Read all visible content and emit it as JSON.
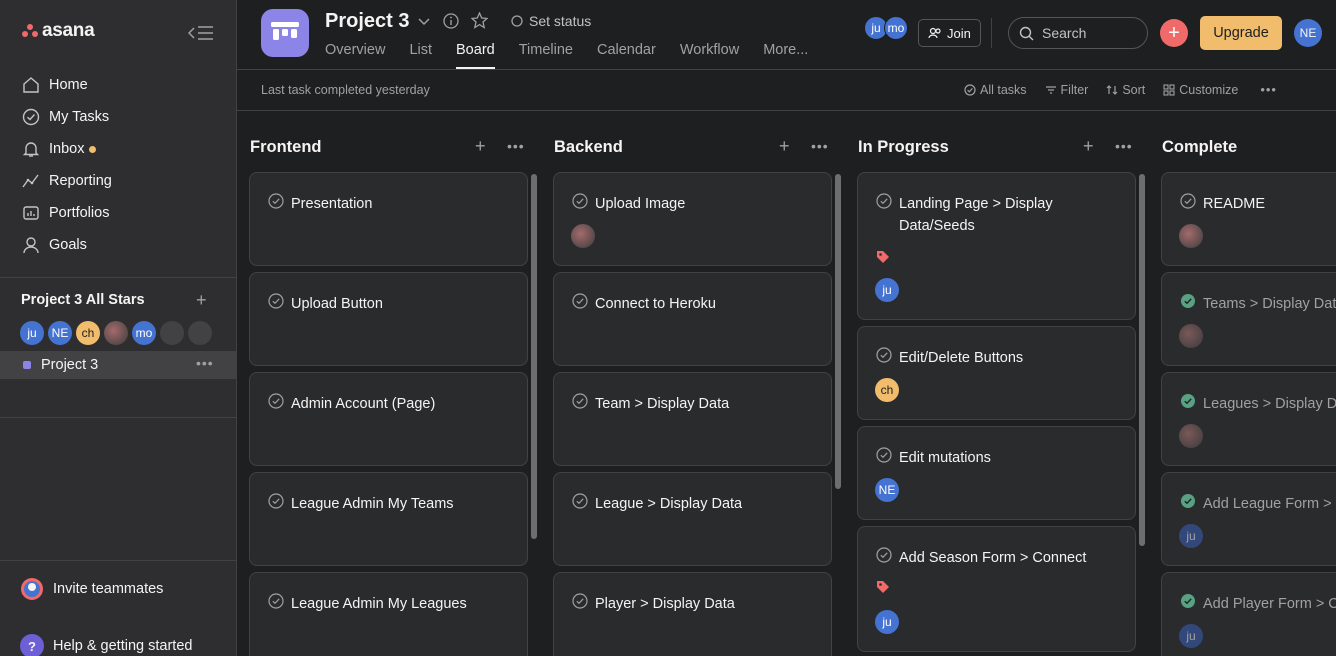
{
  "sidebar": {
    "logo": "asana",
    "nav": [
      {
        "label": "Home",
        "icon": "home-icon"
      },
      {
        "label": "My Tasks",
        "icon": "check-circle-icon"
      },
      {
        "label": "Inbox",
        "icon": "bell-icon"
      },
      {
        "label": "Reporting",
        "icon": "chart-line-icon"
      },
      {
        "label": "Portfolios",
        "icon": "portfolio-icon"
      },
      {
        "label": "Goals",
        "icon": "goals-icon"
      }
    ],
    "team_title": "Project 3 All Stars",
    "team_members": [
      "ju",
      "NE",
      "ch",
      "",
      "mo",
      "",
      ""
    ],
    "project": "Project 3",
    "invite": "Invite teammates",
    "help": "Help & getting started"
  },
  "header": {
    "title": "Project 3",
    "set_status": "Set status",
    "tabs": [
      "Overview",
      "List",
      "Board",
      "Timeline",
      "Calendar",
      "Workflow",
      "More..."
    ],
    "active_tab": "Board",
    "members": [
      "ju",
      "mo"
    ],
    "join": "Join",
    "search_placeholder": "Search",
    "upgrade": "Upgrade",
    "user": "NE"
  },
  "subbar": {
    "last_task": "Last task completed yesterday",
    "actions": [
      "All tasks",
      "Filter",
      "Sort",
      "Customize"
    ]
  },
  "colors": {
    "accent": "#f06a6a",
    "upgrade": "#f1bd6c",
    "project": "#8d84e8"
  },
  "board": {
    "columns": [
      {
        "name": "Frontend",
        "cards": [
          "Presentation",
          "Upload Button",
          "Admin Account (Page)",
          "League Admin My Teams",
          "League Admin My Leagues"
        ]
      },
      {
        "name": "Backend",
        "cards": [
          "Upload Image",
          "Connect to Heroku",
          "Team > Display Data",
          "League > Display Data",
          "Player > Display Data"
        ]
      },
      {
        "name": "In Progress",
        "cards": [
          "Landing Page > Display Data/Seeds",
          "Edit/Delete Buttons",
          "Edit mutations",
          "Add Season Form > Connect"
        ]
      },
      {
        "name": "Complete",
        "cards": [
          "README",
          "Teams > Display Data",
          "Leagues > Display Data",
          "Add League Form > C",
          "Add Player Form > C"
        ]
      }
    ],
    "card_avatars": {
      "progress_0": "ju",
      "progress_1": "ch",
      "progress_2": "NE",
      "progress_3": "ju",
      "complete_3": "ju",
      "complete_4": "ju"
    }
  }
}
